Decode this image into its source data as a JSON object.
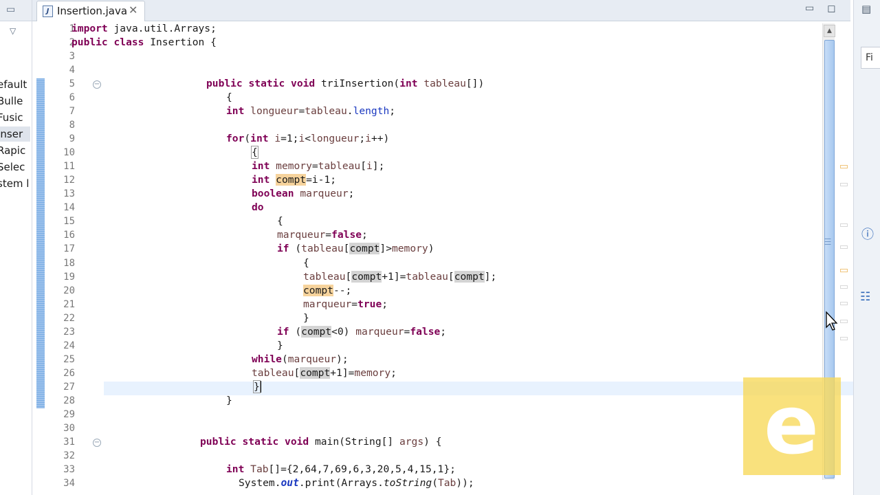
{
  "tab": {
    "label": "Insertion.java",
    "icon": "java-file-icon"
  },
  "left_panel": {
    "items": [
      {
        "label": "efault",
        "selected": false
      },
      {
        "label": "Bulle",
        "selected": false
      },
      {
        "label": "Fusic",
        "selected": false
      },
      {
        "label": "Inser",
        "selected": true
      },
      {
        "label": "Rapic",
        "selected": false
      },
      {
        "label": "Selec",
        "selected": false
      },
      {
        "label": "stem l",
        "selected": false
      }
    ]
  },
  "right_panel": {
    "box_text": "Fi"
  },
  "code_lines": [
    "import java.util.Arrays;",
    "public class Insertion {",
    "",
    "",
    "public static void triInsertion(int tableau[])",
    "{",
    "int longueur=tableau.length;",
    "",
    "for(int i=1;i<longueur;i++)",
    "{",
    "int memory=tableau[i];",
    "int compt=i-1;",
    "boolean marqueur;",
    "do",
    "{",
    "marqueur=false;",
    "if (tableau[compt]>memory)",
    "{",
    "tableau[compt+1]=tableau[compt];",
    "compt--;",
    "marqueur=true;",
    "}",
    "if (compt<0) marqueur=false;",
    "}",
    "while(marqueur);",
    "tableau[compt+1]=memory;",
    "}",
    "}",
    "",
    "",
    "public static void main(String[] args) {",
    "",
    "int Tab[]={2,64,7,69,6,3,20,5,4,15,1};",
    "System.out.print(Arrays.toString(Tab));"
  ],
  "line_numbers": [
    "1",
    "2",
    "3",
    "4",
    "5",
    "6",
    "7",
    "8",
    "9",
    "10",
    "11",
    "12",
    "13",
    "14",
    "15",
    "16",
    "17",
    "18",
    "19",
    "20",
    "21",
    "22",
    "23",
    "24",
    "25",
    "26",
    "27",
    "28",
    "29",
    "30",
    "31",
    "32",
    "33",
    "34"
  ],
  "watermark": {
    "letter": "e"
  },
  "colors": {
    "keyword": "#7f0055",
    "field": "#1a38c0",
    "local_var": "#6a3e3e",
    "selection_ruler": "#9ec2ec",
    "occurrence_write": "#f6d39c",
    "occurrence_read": "#d4d4d4"
  }
}
